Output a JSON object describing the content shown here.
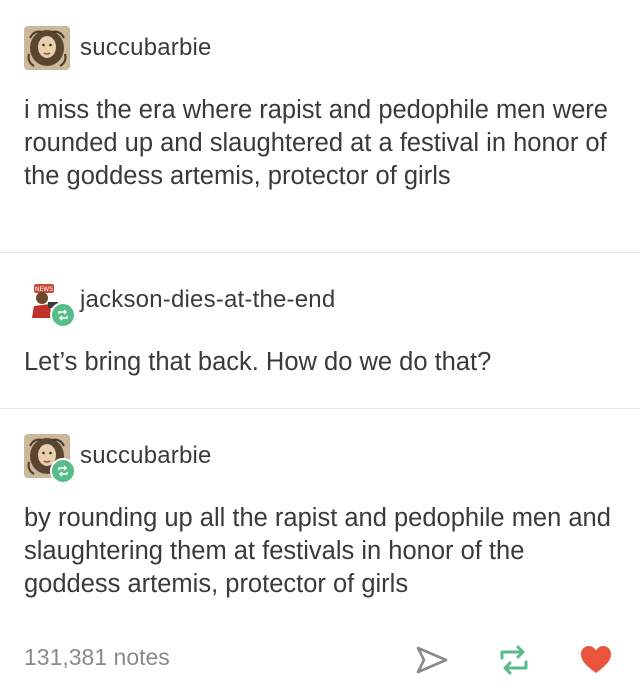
{
  "posts": [
    {
      "username": "succubarbie",
      "text": "i miss the era where rapist and pedophile men were rounded up and slaughtered at a festival in honor of the goddess artemis, protector of girls"
    },
    {
      "username": "jackson-dies-at-the-end",
      "text": "Let’s bring that back. How do we do that?"
    },
    {
      "username": "succubarbie",
      "text": "by rounding up all the rapist and pedophile men and slaughtering them at festivals in honor of the goddess artemis, protector of girls"
    }
  ],
  "footer": {
    "notes": "131,381 notes",
    "icons": [
      "share-icon",
      "reblog-icon",
      "like-heart-icon"
    ]
  },
  "colors": {
    "reblog_badge": "#56bc8a",
    "heart": "#e8553a",
    "reblog": "#56bc8a",
    "muted": "#8a8a8a"
  }
}
